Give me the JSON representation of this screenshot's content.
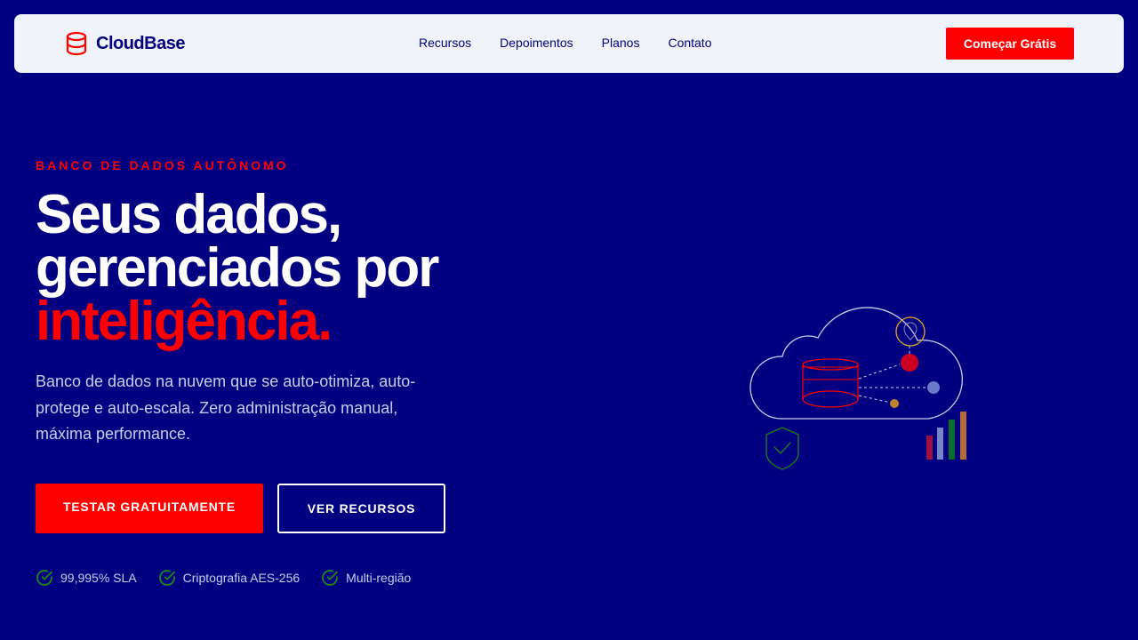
{
  "nav": {
    "brand": "CloudBase",
    "brand_icon": "database-icon",
    "links": [
      "Recursos",
      "Depoimentos",
      "Planos",
      "Contato"
    ],
    "cta": "Começar Grátis"
  },
  "hero": {
    "eyebrow": "BANCO DE DADOS AUTÔNOMO",
    "headline_line1": "Seus dados,",
    "headline_line2": "gerenciados por",
    "headline_highlight": "inteligência.",
    "subtitle": "Banco de dados na nuvem que se auto-otimiza, auto-protege e auto-escala. Zero administração manual, máxima performance.",
    "primary_button": "TESTAR GRATUITAMENTE",
    "secondary_button": "VER RECURSOS",
    "badges": [
      {
        "icon": "check-circle-icon",
        "label": "99,995% SLA"
      },
      {
        "icon": "check-circle-icon",
        "label": "Criptografia AES-256"
      },
      {
        "icon": "check-circle-icon",
        "label": "Multi-região"
      }
    ]
  },
  "illustration": {
    "icons": [
      "cloud-icon",
      "database-icon",
      "ai-brain-icon",
      "shield-check-icon",
      "bar-chart-icon"
    ]
  },
  "colors": {
    "background": "#000080",
    "accent": "#ff0000",
    "nav_background": "#f1f3fa",
    "success": "#1a8a1a"
  }
}
